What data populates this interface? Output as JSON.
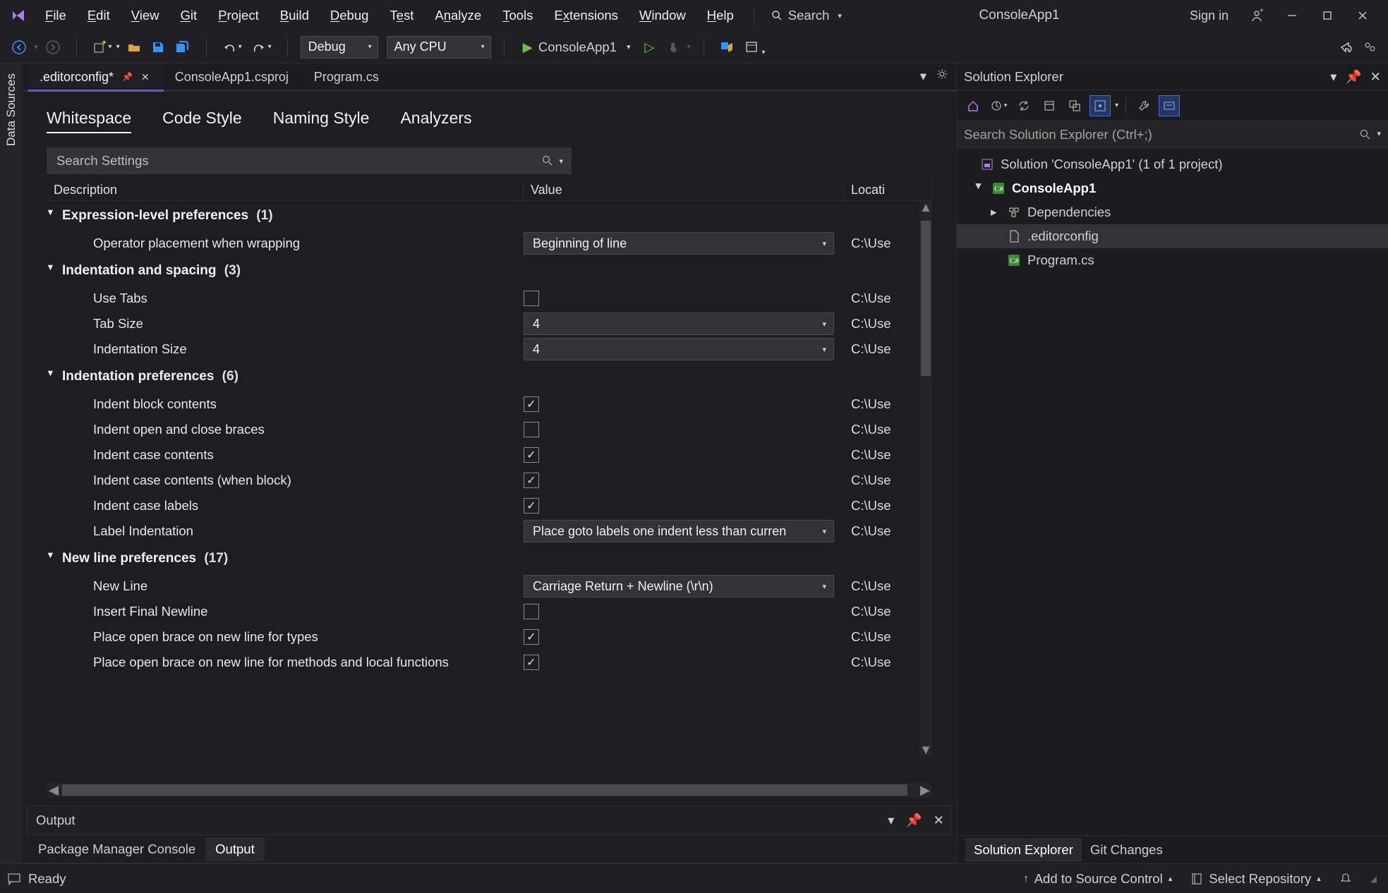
{
  "titlebar": {
    "menu": [
      "File",
      "Edit",
      "View",
      "Git",
      "Project",
      "Build",
      "Debug",
      "Test",
      "Analyze",
      "Tools",
      "Extensions",
      "Window",
      "Help"
    ],
    "search_label": "Search",
    "app_name": "ConsoleApp1",
    "signin": "Sign in"
  },
  "toolbar": {
    "config": "Debug",
    "platform": "Any CPU",
    "run_target": "ConsoleApp1"
  },
  "left_rail": {
    "tab": "Data Sources"
  },
  "editor_tabs": [
    ".editorconfig*",
    "ConsoleApp1.csproj",
    "Program.cs"
  ],
  "cfg_tabs": [
    "Whitespace",
    "Code Style",
    "Naming Style",
    "Analyzers"
  ],
  "search_placeholder": "Search Settings",
  "grid_headers": {
    "description": "Description",
    "value": "Value",
    "location": "Locati"
  },
  "location_stub": "C:\\Use",
  "groups": [
    {
      "name": "Expression-level preferences",
      "count": "(1)",
      "items": [
        {
          "d": "Operator placement when wrapping",
          "t": "dd",
          "v": "Beginning of line"
        }
      ]
    },
    {
      "name": "Indentation and spacing",
      "count": "(3)",
      "items": [
        {
          "d": "Use Tabs",
          "t": "chk",
          "v": false
        },
        {
          "d": "Tab Size",
          "t": "dd",
          "v": "4"
        },
        {
          "d": "Indentation Size",
          "t": "dd",
          "v": "4"
        }
      ]
    },
    {
      "name": "Indentation preferences",
      "count": "(6)",
      "items": [
        {
          "d": "Indent block contents",
          "t": "chk",
          "v": true
        },
        {
          "d": "Indent open and close braces",
          "t": "chk",
          "v": false
        },
        {
          "d": "Indent case contents",
          "t": "chk",
          "v": true
        },
        {
          "d": "Indent case contents (when block)",
          "t": "chk",
          "v": true
        },
        {
          "d": "Indent case labels",
          "t": "chk",
          "v": true
        },
        {
          "d": "Label Indentation",
          "t": "dd",
          "v": "Place goto labels one indent less than curren"
        }
      ]
    },
    {
      "name": "New line preferences",
      "count": "(17)",
      "items": [
        {
          "d": "New Line",
          "t": "dd",
          "v": "Carriage Return + Newline (\\r\\n)"
        },
        {
          "d": "Insert Final Newline",
          "t": "chk",
          "v": false
        },
        {
          "d": "Place open brace on new line for types",
          "t": "chk",
          "v": true
        },
        {
          "d": "Place open brace on new line for methods and local functions",
          "t": "chk",
          "v": true
        }
      ]
    }
  ],
  "output": {
    "title": "Output"
  },
  "bottom_tabs": [
    "Package Manager Console",
    "Output"
  ],
  "solution_explorer": {
    "title": "Solution Explorer",
    "search_placeholder": "Search Solution Explorer (Ctrl+;)",
    "nodes": {
      "solution": "Solution 'ConsoleApp1' (1 of 1 project)",
      "project": "ConsoleApp1",
      "deps": "Dependencies",
      "file1": ".editorconfig",
      "file2": "Program.cs"
    },
    "bottom_tabs": [
      "Solution Explorer",
      "Git Changes"
    ]
  },
  "statusbar": {
    "ready": "Ready",
    "add_source": "Add to Source Control",
    "select_repo": "Select Repository"
  }
}
